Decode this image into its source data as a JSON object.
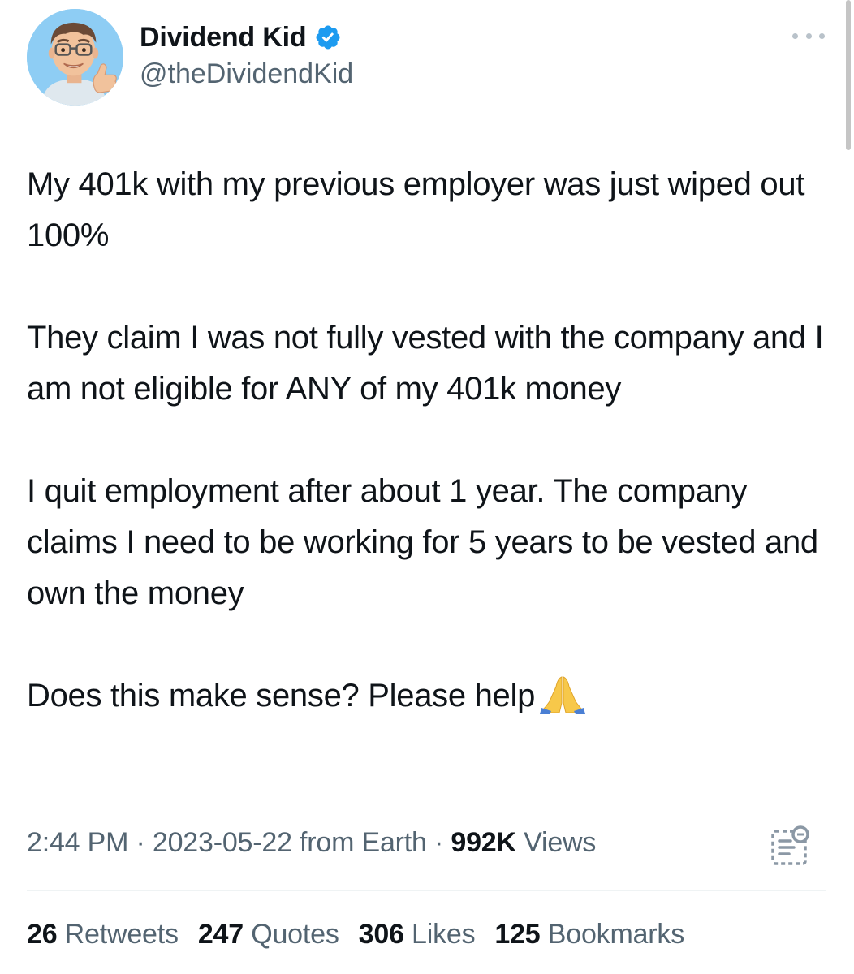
{
  "author": {
    "display_name": "Dividend Kid",
    "handle": "@theDividendKid",
    "verified": true,
    "verified_color": "#1d9bf0",
    "avatar_bg": "#8ecdf4"
  },
  "tweet": {
    "paragraphs": [
      "My 401k with my previous employer was just wiped out 100%",
      "They claim I was not fully vested with the company and I am not eligible for ANY of my 401k money",
      "I quit employment after about 1 year. The company claims I need to be working for 5 years to be vested and own the money",
      "Does this make sense? Please help"
    ],
    "trailing_emoji": "folded-hands"
  },
  "meta": {
    "time": "2:44 PM",
    "separator": " · ",
    "date": "2023-05-22",
    "source": "from Earth",
    "views_count": "992K",
    "views_label": "Views"
  },
  "stats": {
    "retweets": {
      "count": "26",
      "label": "Retweets"
    },
    "quotes": {
      "count": "247",
      "label": "Quotes"
    },
    "likes": {
      "count": "306",
      "label": "Likes"
    },
    "bookmarks": {
      "count": "125",
      "label": "Bookmarks"
    }
  },
  "icons": {
    "more": "more-options-icon",
    "analytics": "view-analytics-icon",
    "verified": "verified-badge-icon"
  }
}
